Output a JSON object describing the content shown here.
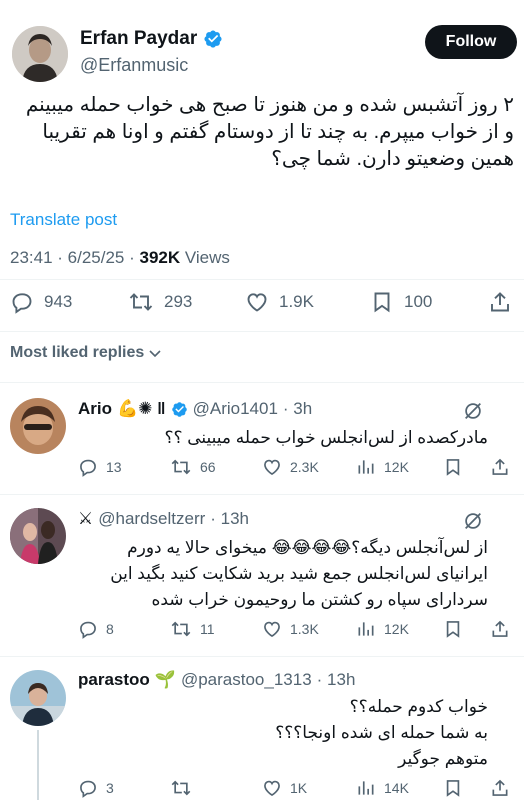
{
  "post": {
    "author_name": "Erfan Paydar",
    "author_handle": "@Erfanmusic",
    "follow_label": "Follow",
    "text_lines": [
      "۲ روز آتشبس شده و من هنوز تا صبح هی خواب حمله میبینم",
      "و از خواب میپرم. به چند تا از دوستام گفتم و اونا هم تقریبا",
      "همین وضعیتو دارن. شما چی؟"
    ],
    "translate_label": "Translate post",
    "time_date": "23:41 · 6/25/25 · ",
    "views_count": "392K",
    "views_label": " Views",
    "stats": {
      "replies": "943",
      "reposts": "293",
      "likes": "1.9K",
      "bookmarks": "100"
    }
  },
  "replies_header": "Most liked replies",
  "replies": [
    {
      "name": "Ario",
      "name_decor": "💪✺ ‖",
      "handle": "@Ario1401",
      "time": "· 3h",
      "text": "مادرکصده از لس‌انجلس خواب حمله میبینی ؟؟",
      "stats": {
        "replies": "13",
        "reposts": "66",
        "likes": "2.3K",
        "views": "12K"
      }
    },
    {
      "name_decor": "⚔",
      "handle": "@hardseltzerr",
      "time": "· 13h",
      "text_lines": [
        "از لس‌آنجلس دیگه؟😂😂😂😂 میخوای حالا یه دورم",
        "ایرانیای لس‌انجلس جمع شید برید شکایت کنید بگید این",
        "سردارای سپاه رو کشتن ما روحیمون خراب شده"
      ],
      "stats": {
        "replies": "8",
        "reposts": "11",
        "likes": "1.3K",
        "views": "12K"
      }
    },
    {
      "name": "parastoo",
      "name_decor": "🌱",
      "handle": "@parastoo_1313",
      "time": "· 13h",
      "text_lines": [
        "خواب کدوم حمله؟؟",
        "به شما حمله ای شده اونجا؟؟؟",
        "متوهم جوگیر"
      ],
      "stats": {
        "replies": "3",
        "reposts": "",
        "likes": "1K",
        "views": "14K"
      }
    }
  ],
  "colors": {
    "accent": "#1d9bf0",
    "text": "#0f1419",
    "secondary": "#536471",
    "divider": "#eff3f4"
  },
  "icons": [
    "verified-badge-icon",
    "reply-icon",
    "repost-icon",
    "like-icon",
    "bookmark-icon",
    "share-icon",
    "views-icon",
    "grok-icon",
    "chevron-down-icon"
  ]
}
